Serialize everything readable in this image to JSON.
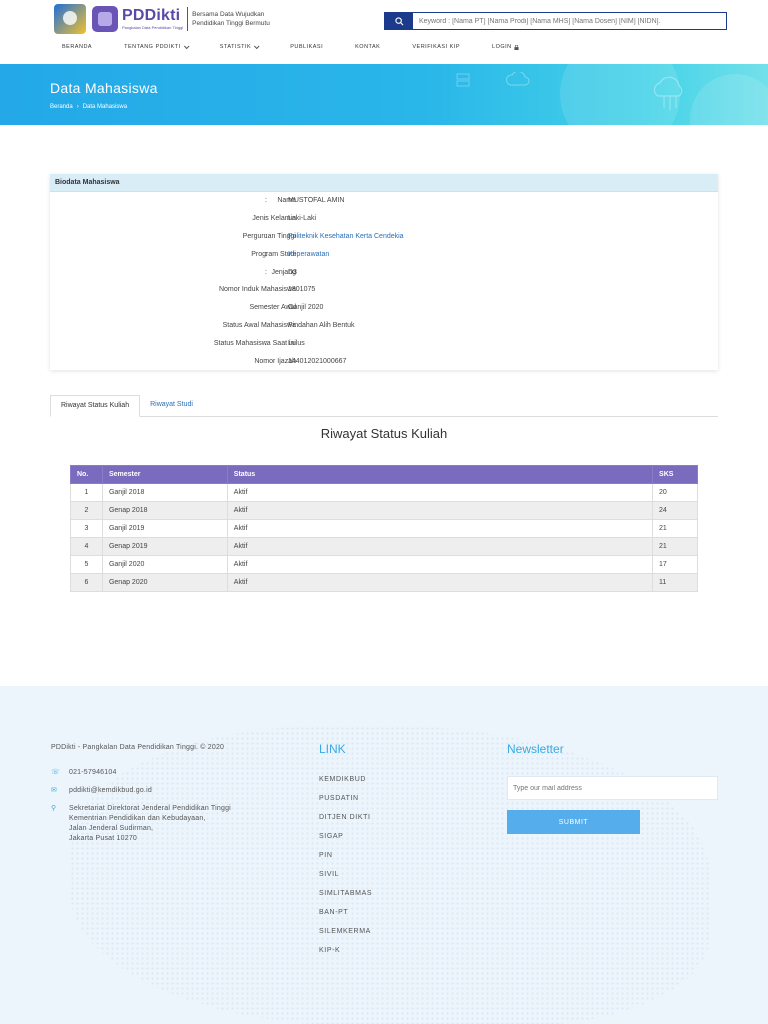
{
  "header": {
    "brand": "PDDikti",
    "brand_sub": "Pangkalan Data Pendidikan Tinggi",
    "tagline_1": "Bersama Data Wujudkan",
    "tagline_2": "Pendidikan Tinggi Bermutu",
    "search_placeholder": "Keyword : [Nama PT] [Nama Prodi] [Nama MHS] [Nama Dosen] [NIM] [NIDN]."
  },
  "nav": {
    "items": [
      {
        "label": "BERANDA"
      },
      {
        "label": "TENTANG PDDIKTI"
      },
      {
        "label": "STATISTIK"
      },
      {
        "label": "PUBLIKASI"
      },
      {
        "label": "KONTAK"
      },
      {
        "label": "VERIFIKASI KIP"
      },
      {
        "label": "LOGIN"
      }
    ]
  },
  "banner": {
    "title": "Data Mahasiswa",
    "crumb_home": "Beranda",
    "crumb_sep": "›",
    "crumb_current": "Data Mahasiswa"
  },
  "biodata": {
    "heading": "Biodata Mahasiswa",
    "rows": [
      {
        "label": "Nama",
        "value": "MUSTOFAL AMIN"
      },
      {
        "label": "Jenis Kelamin",
        "value": "Laki-Laki"
      },
      {
        "label": "Perguruan Tinggi",
        "value": "Politeknik Kesehatan Kerta Cendekia"
      },
      {
        "label": "Program Studi",
        "value": "Keperawatan"
      },
      {
        "label": "Jenjang",
        "value": "D3"
      },
      {
        "label": "Nomor Induk Mahasiswa",
        "value": "1801075"
      },
      {
        "label": "Semester Awal",
        "value": "Ganjil 2020"
      },
      {
        "label": "Status Awal Mahasiswa",
        "value": "Pindahan Alih Bentuk"
      },
      {
        "label": "Status Mahasiswa Saat ini",
        "value": "Lulus"
      },
      {
        "label": "Nomor Ijazah",
        "value": "144012021000667"
      }
    ]
  },
  "tabs": {
    "tab1": "Riwayat Status Kuliah",
    "tab2": "Riwayat Studi"
  },
  "section_title": "Riwayat Status Kuliah",
  "table": {
    "headers": [
      "No.",
      "Semester",
      "Status",
      "SKS"
    ],
    "rows": [
      [
        "1",
        "Ganjil 2018",
        "Aktif",
        "20"
      ],
      [
        "2",
        "Genap 2018",
        "Aktif",
        "24"
      ],
      [
        "3",
        "Ganjil 2019",
        "Aktif",
        "21"
      ],
      [
        "4",
        "Genap 2019",
        "Aktif",
        "21"
      ],
      [
        "5",
        "Ganjil 2020",
        "Aktif",
        "17"
      ],
      [
        "6",
        "Genap 2020",
        "Aktif",
        "11"
      ]
    ]
  },
  "footer": {
    "copyright": "PDDikti - Pangkalan Data Pendidikan Tinggi. © 2020",
    "phone": "021-57946104",
    "email": "pddikti@kemdikbud.go.id",
    "address_1": "Sekretariat Direktorat Jenderal Pendidikan Tinggi",
    "address_2": "Kementrian Pendidikan dan Kebudayaan,",
    "address_3": "Jalan Jenderal Sudirman,",
    "address_4": "Jakarta Pusat 10270",
    "link_heading": "LINK",
    "links": [
      "KEMDIKBUD",
      "PUSDATIN",
      "DITJEN DIKTI",
      "SIGAP",
      "PIN",
      "SIVIL",
      "SIMLITABMAS",
      "BAN-PT",
      "SILEMKERMA",
      "KIP-K"
    ],
    "newsletter_heading": "Newsletter",
    "newsletter_placeholder": "Type our mail address",
    "submit_label": "SUBMIT"
  },
  "colors": {
    "brand_purple": "#5a4aa8",
    "banner_blue": "#29b6e9",
    "table_header": "#7b6bbf",
    "link_blue": "#2a6fb6",
    "accent_cyan": "#3aa9e0"
  }
}
